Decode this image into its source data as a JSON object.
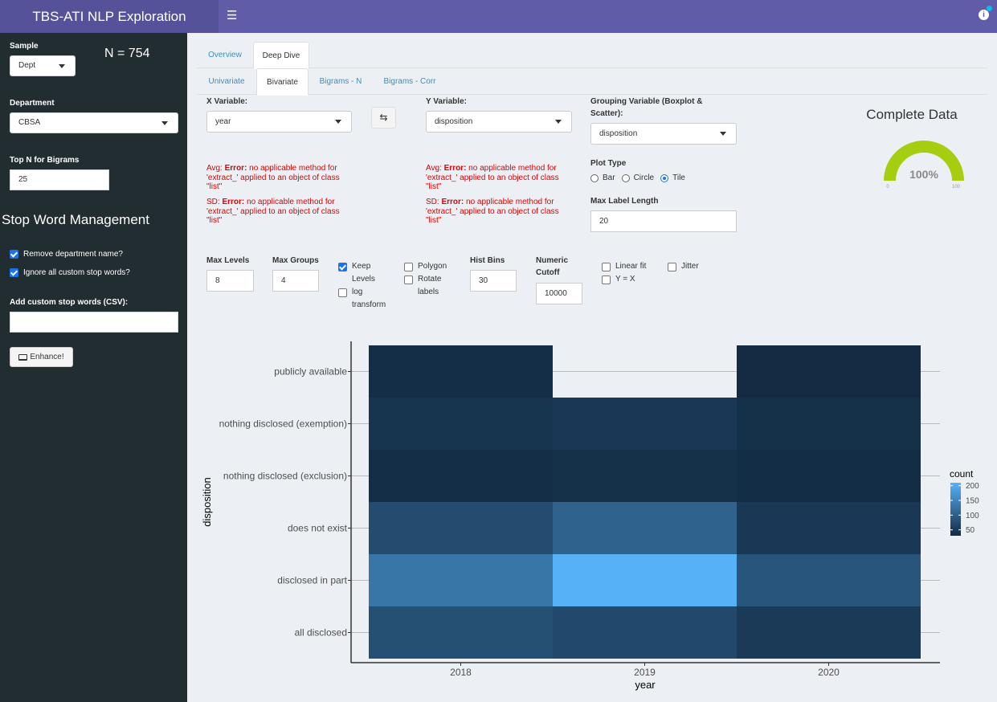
{
  "header": {
    "title": "TBS-ATI NLP Exploration",
    "menu_icon": "hamburger-icon",
    "info_icon": "info-icon"
  },
  "sidebar": {
    "sample_label": "Sample",
    "sample_value": "Dept",
    "n_text": "N = 754",
    "department_label": "Department",
    "department_value": "CBSA",
    "topn_label": "Top N for Bigrams",
    "topn_value": "25",
    "stopword_heading": "Stop Word Management",
    "remove_dept_label": "Remove department name?",
    "remove_dept_checked": true,
    "ignore_custom_label": "Ignore all custom stop words?",
    "ignore_custom_checked": true,
    "custom_label": "Add custom stop words (CSV):",
    "custom_value": "",
    "enhance_label": "Enhance!"
  },
  "tabs_main": [
    {
      "label": "Overview",
      "active": false
    },
    {
      "label": "Deep Dive",
      "active": true
    }
  ],
  "tabs_sub": [
    {
      "label": "Univariate",
      "active": false
    },
    {
      "label": "Bivariate",
      "active": true
    },
    {
      "label": "Bigrams - N",
      "active": false
    },
    {
      "label": "Bigrams - Corr",
      "active": false
    }
  ],
  "controls": {
    "x_label": "X Variable:",
    "x_value": "year",
    "y_label": "Y Variable:",
    "y_value": "disposition",
    "group_label": "Grouping Variable (Boxplot & Scatter):",
    "group_value": "disposition",
    "plot_type_label": "Plot Type",
    "plot_types": [
      "Bar",
      "Circle",
      "Tile"
    ],
    "plot_type_selected": "Tile",
    "max_label_len_label": "Max Label Length",
    "max_label_len_value": "20",
    "max_levels_label": "Max Levels",
    "max_levels_value": "8",
    "max_groups_label": "Max Groups",
    "max_groups_value": "4",
    "keep_levels_label": "Keep Levels",
    "keep_levels_checked": true,
    "log_label": "log transform",
    "log_checked": false,
    "polygon_label": "Polygon",
    "rotate_label": "Rotate labels",
    "hist_bins_label": "Hist Bins",
    "hist_bins_value": "30",
    "numeric_cutoff_label": "Numeric Cutoff",
    "numeric_cutoff_value": "10000",
    "linear_fit_label": "Linear fit",
    "yx_label": "Y = X",
    "jitter_label": "Jitter"
  },
  "errors": {
    "x_avg_prefix": "Avg: ",
    "x_sd_prefix": "SD: ",
    "y_avg_prefix": "Avg: ",
    "y_sd_prefix": "SD: ",
    "error_word": "Error:",
    "error_text": " no applicable method for 'extract_' applied to an object of class \"list\""
  },
  "gauge": {
    "title": "Complete Data",
    "value": 100,
    "value_label": "100%",
    "min": "0",
    "max": "100",
    "color": "#a6ce10"
  },
  "chart_data": {
    "type": "heatmap",
    "xlabel": "year",
    "ylabel": "disposition",
    "x": [
      "2018",
      "2019",
      "2020"
    ],
    "y": [
      "publicly available",
      "nothing disclosed (exemption)",
      "nothing disclosed (exclusion)",
      "does not exist",
      "disclosed in part",
      "all disclosed"
    ],
    "values": [
      [
        30,
        null,
        25
      ],
      [
        40,
        45,
        32
      ],
      [
        30,
        32,
        28
      ],
      [
        75,
        110,
        45
      ],
      [
        140,
        230,
        90
      ],
      [
        80,
        70,
        48
      ]
    ],
    "legend_title": "count",
    "legend_ticks": [
      200,
      150,
      100,
      50
    ],
    "color_low": "#132b43",
    "color_high": "#56b1f7",
    "value_range": [
      25,
      230
    ]
  }
}
